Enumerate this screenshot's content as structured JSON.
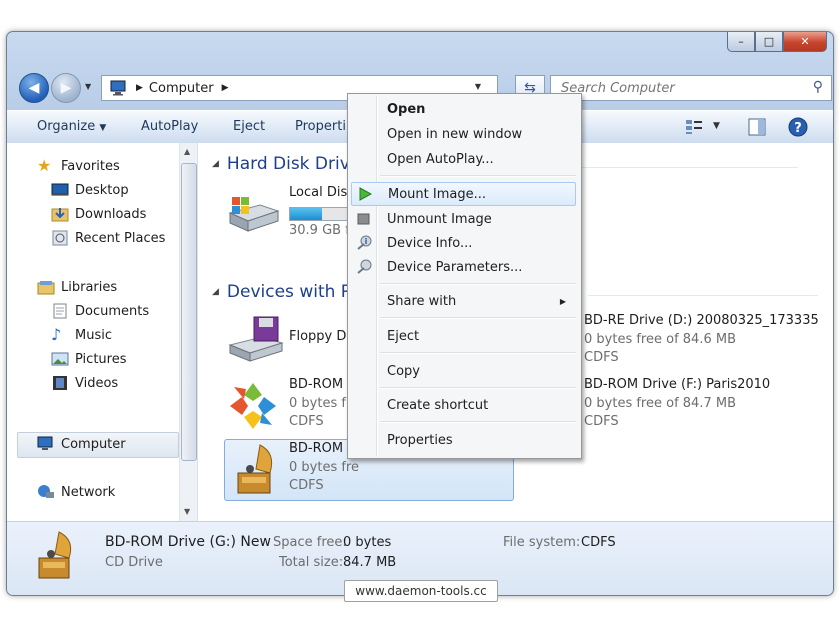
{
  "window": {
    "caption_buttons": {
      "minimize": "–",
      "maximize": "□",
      "close": "✕"
    }
  },
  "nav": {
    "breadcrumb": [
      "Computer"
    ],
    "search_placeholder": "Search Computer"
  },
  "toolbar": {
    "organize": "Organize",
    "autoplay": "AutoPlay",
    "eject": "Eject",
    "properties": "Properti"
  },
  "sidebar": {
    "favorites": "Favorites",
    "desktop": "Desktop",
    "downloads": "Downloads",
    "recent_places": "Recent Places",
    "libraries": "Libraries",
    "documents": "Documents",
    "music": "Music",
    "pictures": "Pictures",
    "videos": "Videos",
    "computer": "Computer",
    "network": "Network"
  },
  "groups": {
    "hard_disk": "Hard Disk Drive",
    "removable": "Devices with Re"
  },
  "items": {
    "local_disk": {
      "name": "Local Disk",
      "free": "30.9 GB fre",
      "used_fraction": 0.45
    },
    "floppy": {
      "name": "Floppy Dis"
    },
    "bdrom_e": {
      "name": "BD-ROM D",
      "free": "0 bytes fre",
      "fs": "CDFS"
    },
    "bdrom_g": {
      "name": "BD-ROM D",
      "free": "0 bytes fre",
      "fs": "CDFS"
    },
    "bdre_d": {
      "name": "BD-RE Drive (D:) 20080325_173335",
      "free": "0 bytes free of 84.6 MB",
      "fs": "CDFS"
    },
    "bdrom_f": {
      "name": "BD-ROM Drive (F:) Paris2010",
      "free": "0 bytes free of 84.7 MB",
      "fs": "CDFS"
    }
  },
  "context_menu": {
    "open": "Open",
    "open_new_window": "Open in new window",
    "open_autoplay": "Open AutoPlay...",
    "mount_image": "Mount Image...",
    "unmount_image": "Unmount Image",
    "device_info": "Device Info...",
    "device_parameters": "Device Parameters...",
    "share_with": "Share with",
    "eject": "Eject",
    "copy": "Copy",
    "create_shortcut": "Create shortcut",
    "properties": "Properties"
  },
  "details": {
    "name": "BD-ROM Drive (G:) New",
    "type": "CD Drive",
    "space_free_label": "Space free:",
    "space_free": "0 bytes",
    "total_size_label": "Total size:",
    "total_size": "84.7 MB",
    "fs_label": "File system:",
    "fs": "CDFS"
  },
  "watermark": "www.daemon-tools.cc"
}
